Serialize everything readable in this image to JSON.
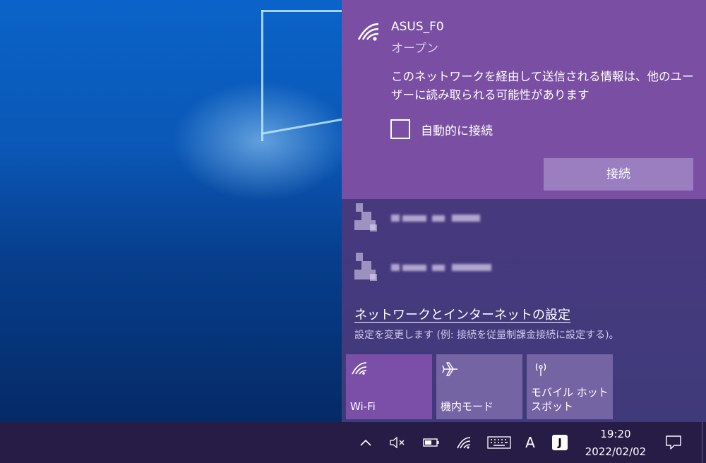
{
  "flyout": {
    "selected_network": {
      "ssid": "ASUS_F0",
      "security": "オープン",
      "warning": "このネットワークを経由して送信される情報は、他のユーザーに読み取られる可能性があります",
      "auto_connect_label": "自動的に接続",
      "auto_connect_checked": false,
      "connect_label": "接続"
    },
    "other_networks_blurred": 2,
    "settings_link": "ネットワークとインターネットの設定",
    "settings_description": "設定を変更します (例: 接続を従量制課金接続に設定する)。",
    "quick_actions": [
      {
        "label": "Wi-Fi",
        "icon": "wifi-icon",
        "active": true
      },
      {
        "label": "機内モード",
        "icon": "airplane-icon",
        "active": false
      },
      {
        "label": "モバイル ホットスポット",
        "icon": "hotspot-icon",
        "active": false
      }
    ]
  },
  "taskbar": {
    "tray_icons": [
      "chevron-up-icon",
      "speaker-muted-icon",
      "battery-icon",
      "wifi-icon",
      "touch-keyboard-icon",
      "ime-mode-icon",
      "japanese-ime-icon"
    ],
    "ime_mode_text": "A",
    "ime_badge_text": "J",
    "time": "19:20",
    "date": "2022/02/02",
    "notification_icon": "action-center-icon"
  },
  "colors": {
    "flyout_bg": "#48397f",
    "selected_bg": "#7a4fa3",
    "connect_button": "#9a7ec0",
    "tile_active": "#7b4ea8",
    "tile_inactive": "#7464a4",
    "taskbar": "#271c45"
  }
}
